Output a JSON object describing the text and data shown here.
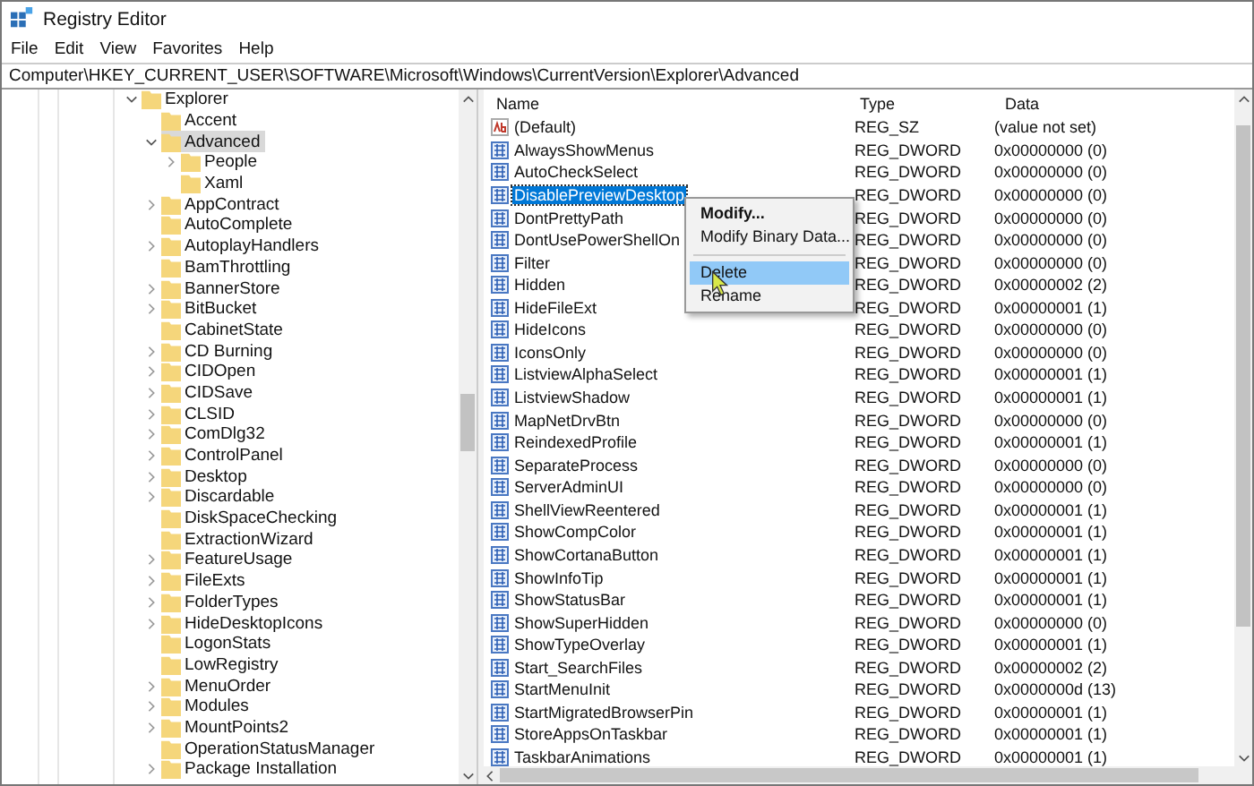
{
  "window": {
    "title": "Registry Editor"
  },
  "menu": [
    "File",
    "Edit",
    "View",
    "Favorites",
    "Help"
  ],
  "address": "Computer\\HKEY_CURRENT_USER\\SOFTWARE\\Microsoft\\Windows\\CurrentVersion\\Explorer\\Advanced",
  "tree": [
    {
      "label": "Explorer",
      "expanded": true,
      "selected": false,
      "children": [
        {
          "label": "Accent",
          "selected": false
        },
        {
          "label": "Advanced",
          "expanded": true,
          "selected": true,
          "children": [
            {
              "label": "People",
              "expanded": false,
              "selected": false
            },
            {
              "label": "Xaml",
              "selected": false
            }
          ]
        },
        {
          "label": "AppContract",
          "expanded": false,
          "selected": false
        },
        {
          "label": "AutoComplete",
          "selected": false
        },
        {
          "label": "AutoplayHandlers",
          "expanded": false,
          "selected": false
        },
        {
          "label": "BamThrottling",
          "selected": false
        },
        {
          "label": "BannerStore",
          "expanded": false,
          "selected": false
        },
        {
          "label": "BitBucket",
          "expanded": false,
          "selected": false
        },
        {
          "label": "CabinetState",
          "selected": false
        },
        {
          "label": "CD Burning",
          "expanded": false,
          "selected": false
        },
        {
          "label": "CIDOpen",
          "expanded": false,
          "selected": false
        },
        {
          "label": "CIDSave",
          "expanded": false,
          "selected": false
        },
        {
          "label": "CLSID",
          "expanded": false,
          "selected": false
        },
        {
          "label": "ComDlg32",
          "expanded": false,
          "selected": false
        },
        {
          "label": "ControlPanel",
          "expanded": false,
          "selected": false
        },
        {
          "label": "Desktop",
          "expanded": false,
          "selected": false
        },
        {
          "label": "Discardable",
          "expanded": false,
          "selected": false
        },
        {
          "label": "DiskSpaceChecking",
          "selected": false
        },
        {
          "label": "ExtractionWizard",
          "selected": false
        },
        {
          "label": "FeatureUsage",
          "expanded": false,
          "selected": false
        },
        {
          "label": "FileExts",
          "expanded": false,
          "selected": false
        },
        {
          "label": "FolderTypes",
          "expanded": false,
          "selected": false
        },
        {
          "label": "HideDesktopIcons",
          "expanded": false,
          "selected": false
        },
        {
          "label": "LogonStats",
          "selected": false
        },
        {
          "label": "LowRegistry",
          "selected": false
        },
        {
          "label": "MenuOrder",
          "expanded": false,
          "selected": false
        },
        {
          "label": "Modules",
          "expanded": false,
          "selected": false
        },
        {
          "label": "MountPoints2",
          "expanded": false,
          "selected": false
        },
        {
          "label": "OperationStatusManager",
          "selected": false
        },
        {
          "label": "Package Installation",
          "expanded": false,
          "selected": false
        }
      ]
    }
  ],
  "table": {
    "columns": [
      "Name",
      "Type",
      "Data"
    ],
    "rows": [
      {
        "kind": "string",
        "name": "(Default)",
        "type": "REG_SZ",
        "data": "(value not set)",
        "selected": false
      },
      {
        "kind": "dword",
        "name": "AlwaysShowMenus",
        "type": "REG_DWORD",
        "data": "0x00000000 (0)",
        "selected": false
      },
      {
        "kind": "dword",
        "name": "AutoCheckSelect",
        "type": "REG_DWORD",
        "data": "0x00000000 (0)",
        "selected": false
      },
      {
        "kind": "dword",
        "name": "DisablePreviewDesktop",
        "type": "REG_DWORD",
        "data": "0x00000000 (0)",
        "selected": true
      },
      {
        "kind": "dword",
        "name": "DontPrettyPath",
        "type": "REG_DWORD",
        "data": "0x00000000 (0)",
        "selected": false
      },
      {
        "kind": "dword",
        "name": "DontUsePowerShellOn",
        "type": "REG_DWORD",
        "data": "0x00000000 (0)",
        "selected": false
      },
      {
        "kind": "dword",
        "name": "Filter",
        "type": "REG_DWORD",
        "data": "0x00000000 (0)",
        "selected": false
      },
      {
        "kind": "dword",
        "name": "Hidden",
        "type": "REG_DWORD",
        "data": "0x00000002 (2)",
        "selected": false
      },
      {
        "kind": "dword",
        "name": "HideFileExt",
        "type": "REG_DWORD",
        "data": "0x00000001 (1)",
        "selected": false
      },
      {
        "kind": "dword",
        "name": "HideIcons",
        "type": "REG_DWORD",
        "data": "0x00000000 (0)",
        "selected": false
      },
      {
        "kind": "dword",
        "name": "IconsOnly",
        "type": "REG_DWORD",
        "data": "0x00000000 (0)",
        "selected": false
      },
      {
        "kind": "dword",
        "name": "ListviewAlphaSelect",
        "type": "REG_DWORD",
        "data": "0x00000001 (1)",
        "selected": false
      },
      {
        "kind": "dword",
        "name": "ListviewShadow",
        "type": "REG_DWORD",
        "data": "0x00000001 (1)",
        "selected": false
      },
      {
        "kind": "dword",
        "name": "MapNetDrvBtn",
        "type": "REG_DWORD",
        "data": "0x00000000 (0)",
        "selected": false
      },
      {
        "kind": "dword",
        "name": "ReindexedProfile",
        "type": "REG_DWORD",
        "data": "0x00000001 (1)",
        "selected": false
      },
      {
        "kind": "dword",
        "name": "SeparateProcess",
        "type": "REG_DWORD",
        "data": "0x00000000 (0)",
        "selected": false
      },
      {
        "kind": "dword",
        "name": "ServerAdminUI",
        "type": "REG_DWORD",
        "data": "0x00000000 (0)",
        "selected": false
      },
      {
        "kind": "dword",
        "name": "ShellViewReentered",
        "type": "REG_DWORD",
        "data": "0x00000001 (1)",
        "selected": false
      },
      {
        "kind": "dword",
        "name": "ShowCompColor",
        "type": "REG_DWORD",
        "data": "0x00000001 (1)",
        "selected": false
      },
      {
        "kind": "dword",
        "name": "ShowCortanaButton",
        "type": "REG_DWORD",
        "data": "0x00000001 (1)",
        "selected": false
      },
      {
        "kind": "dword",
        "name": "ShowInfoTip",
        "type": "REG_DWORD",
        "data": "0x00000001 (1)",
        "selected": false
      },
      {
        "kind": "dword",
        "name": "ShowStatusBar",
        "type": "REG_DWORD",
        "data": "0x00000001 (1)",
        "selected": false
      },
      {
        "kind": "dword",
        "name": "ShowSuperHidden",
        "type": "REG_DWORD",
        "data": "0x00000000 (0)",
        "selected": false
      },
      {
        "kind": "dword",
        "name": "ShowTypeOverlay",
        "type": "REG_DWORD",
        "data": "0x00000001 (1)",
        "selected": false
      },
      {
        "kind": "dword",
        "name": "Start_SearchFiles",
        "type": "REG_DWORD",
        "data": "0x00000002 (2)",
        "selected": false
      },
      {
        "kind": "dword",
        "name": "StartMenuInit",
        "type": "REG_DWORD",
        "data": "0x0000000d (13)",
        "selected": false
      },
      {
        "kind": "dword",
        "name": "StartMigratedBrowserPin",
        "type": "REG_DWORD",
        "data": "0x00000001 (1)",
        "selected": false
      },
      {
        "kind": "dword",
        "name": "StoreAppsOnTaskbar",
        "type": "REG_DWORD",
        "data": "0x00000001 (1)",
        "selected": false
      },
      {
        "kind": "dword",
        "name": "TaskbarAnimations",
        "type": "REG_DWORD",
        "data": "0x00000001 (1)",
        "selected": false
      }
    ]
  },
  "context_menu": [
    {
      "kind": "item",
      "label": "Modify...",
      "default": true,
      "selected": false
    },
    {
      "kind": "item",
      "label": "Modify Binary Data...",
      "default": false,
      "selected": false
    },
    {
      "kind": "separator"
    },
    {
      "kind": "item",
      "label": "Delete",
      "default": false,
      "selected": true
    },
    {
      "kind": "item",
      "label": "Rename",
      "default": false,
      "selected": false
    }
  ]
}
